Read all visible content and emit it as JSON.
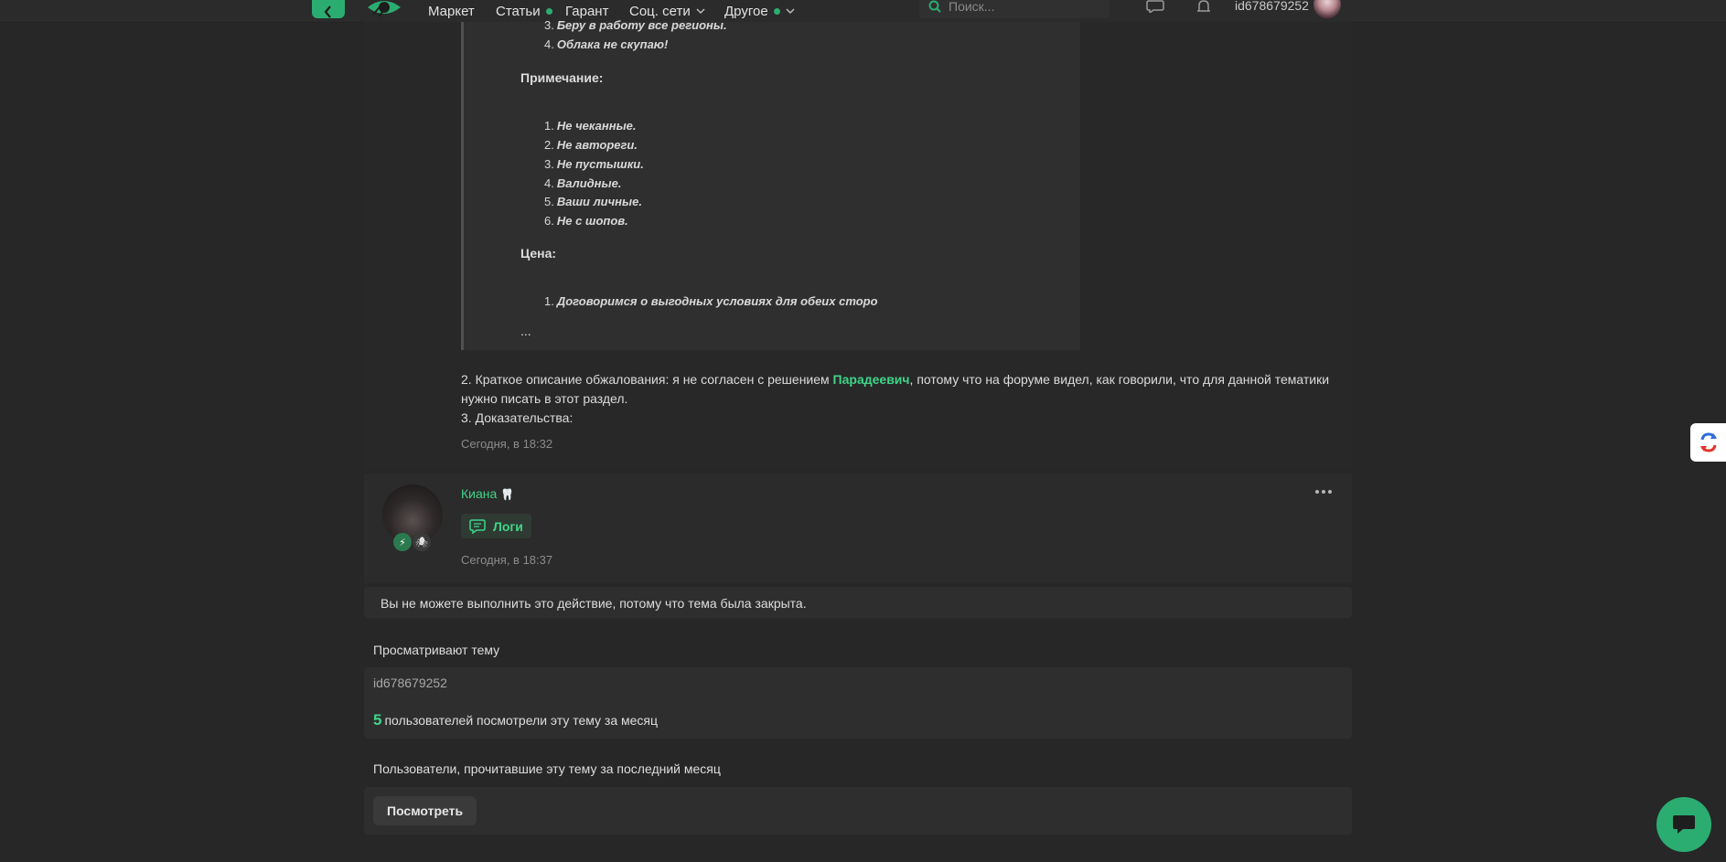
{
  "header": {
    "nav": [
      {
        "label": "Маркет"
      },
      {
        "label": "Статьи"
      },
      {
        "label": "Гарант"
      },
      {
        "label": "Соц. сети"
      },
      {
        "label": "Другое"
      }
    ],
    "search_placeholder": "Поиск...",
    "username": "id678679252"
  },
  "quote": {
    "list_top": [
      {
        "n": "3.",
        "text": "Беру в работу все регионы."
      },
      {
        "n": "4.",
        "text": "Облака не скупаю!"
      }
    ],
    "note_label": "Примечание:",
    "notes": [
      {
        "n": "1.",
        "text": "Не чеканные."
      },
      {
        "n": "2.",
        "text": "Не автореги."
      },
      {
        "n": "3.",
        "text": "Не пустышки."
      },
      {
        "n": "4.",
        "text": "Валидные."
      },
      {
        "n": "5.",
        "text": "Ваши личные."
      },
      {
        "n": "6.",
        "text": "Не с шопов."
      }
    ],
    "price_label": "Цена:",
    "price_items": [
      {
        "n": "1.",
        "text": "Договоримся о выгодных условиях для обеих сторо"
      }
    ],
    "ellipsis": "..."
  },
  "post": {
    "line1_before": "2. Краткое описание обжалования: я не согласен с решением ",
    "mention": "Парадеевич",
    "line1_after": ", потому что на форуме видел, как говорили, что для данной тематики нужно писать в этот раздел.",
    "line2": "3. Доказательства:",
    "time": "Сегодня, в 18:32"
  },
  "reply": {
    "author": "Киана",
    "author_emoji": "🦷",
    "logs_label": "Логи",
    "time": "Сегодня, в 18:37"
  },
  "notice": "Вы не можете выполнить это действие, потому что тема была закрыта.",
  "viewing": {
    "title": "Просматривают тему",
    "user": "id678679252",
    "count": "5",
    "count_text": "пользователей посмотрели эту тему за месяц"
  },
  "readers": {
    "title": "Пользователи, прочитавшие эту тему за последний месяц",
    "button": "Посмотреть"
  },
  "colors": {
    "accent": "#2bad72",
    "mention": "#3fd589",
    "background": "#272727"
  }
}
